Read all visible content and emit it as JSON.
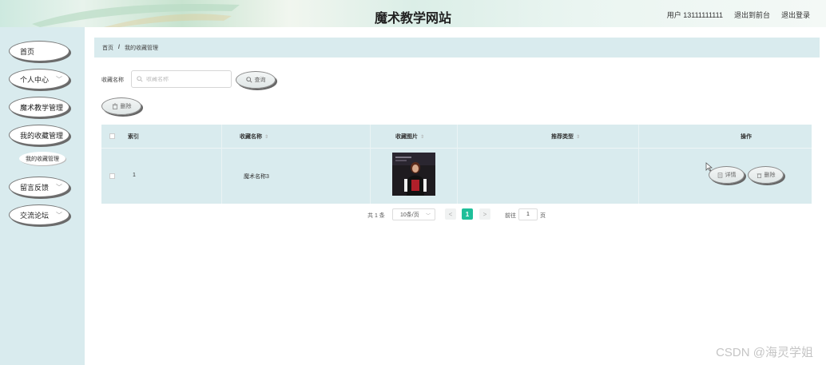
{
  "header": {
    "site_title": "魔术教学网站",
    "user_label": "用户 13111111111",
    "back_to_front": "退出到前台",
    "logout": "退出登录"
  },
  "sidebar": {
    "items": [
      {
        "label": "首页",
        "has_chevron": false
      },
      {
        "label": "个人中心",
        "has_chevron": true
      },
      {
        "label": "魔术教学管理",
        "has_chevron": false
      },
      {
        "label": "我的收藏管理",
        "has_chevron": false
      },
      {
        "label": "留言反馈",
        "has_chevron": true
      },
      {
        "label": "交流论坛",
        "has_chevron": true
      }
    ],
    "sub_item": "我的收藏管理",
    "chevron_icon": "chevron-down-icon"
  },
  "breadcrumb": {
    "home": "首页",
    "separator": "/",
    "current": "我的收藏管理"
  },
  "search": {
    "label": "收藏名称",
    "placeholder": "收藏名称",
    "query_button": "查询",
    "delete_button": "删除"
  },
  "table": {
    "headers": {
      "index": "索引",
      "name": "收藏名称",
      "image": "收藏图片",
      "type": "推荐类型",
      "actions": "操作"
    },
    "rows": [
      {
        "index": "1",
        "name": "魔术名称3",
        "type": "",
        "detail_button": "详情",
        "delete_button": "删除"
      }
    ]
  },
  "pagination": {
    "total": "共 1 条",
    "page_size": "10条/页",
    "prev": "<",
    "current_page": "1",
    "next": ">",
    "goto_label": "前往",
    "goto_value": "1",
    "goto_unit": "页"
  },
  "watermark": "CSDN @海灵学姐",
  "colors": {
    "sidebar_bg": "#d9ebee",
    "accent": "#1fbf9a"
  }
}
